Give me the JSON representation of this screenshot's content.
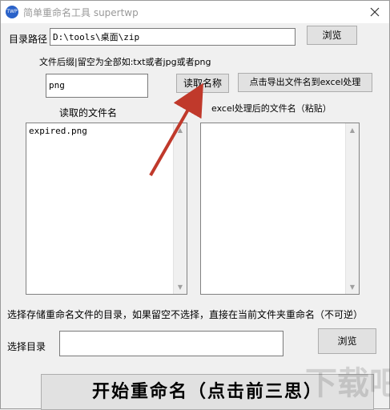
{
  "window": {
    "title": "简单重命名工具 supertwp",
    "icon_text": "TWP"
  },
  "dir_path": {
    "label": "目录路径",
    "value": "D:\\tools\\桌面\\zip",
    "browse_label": "浏览"
  },
  "suffix": {
    "hint": "文件后缀|留空为全部如:txt或者jpg或者png",
    "value": "png"
  },
  "buttons": {
    "read_names": "读取名称",
    "export_excel": "点击导出文件名到excel处理"
  },
  "read_list": {
    "label": "读取的文件名",
    "items": [
      "expired.png"
    ]
  },
  "excel_list": {
    "label": "excel处理后的文件名（粘贴）"
  },
  "target_dir": {
    "hint": "选择存储重命名文件的目录，如果留空不选择，直接在当前文件夹重命名（不可逆）",
    "label": "选择目录",
    "value": "",
    "browse_label": "浏览"
  },
  "start_button": {
    "label": "开始重命名（点击前三思）"
  },
  "watermark": {
    "text": "下载吧"
  },
  "colors": {
    "arrow": "#c0392b",
    "icon": "#2a62c9"
  }
}
